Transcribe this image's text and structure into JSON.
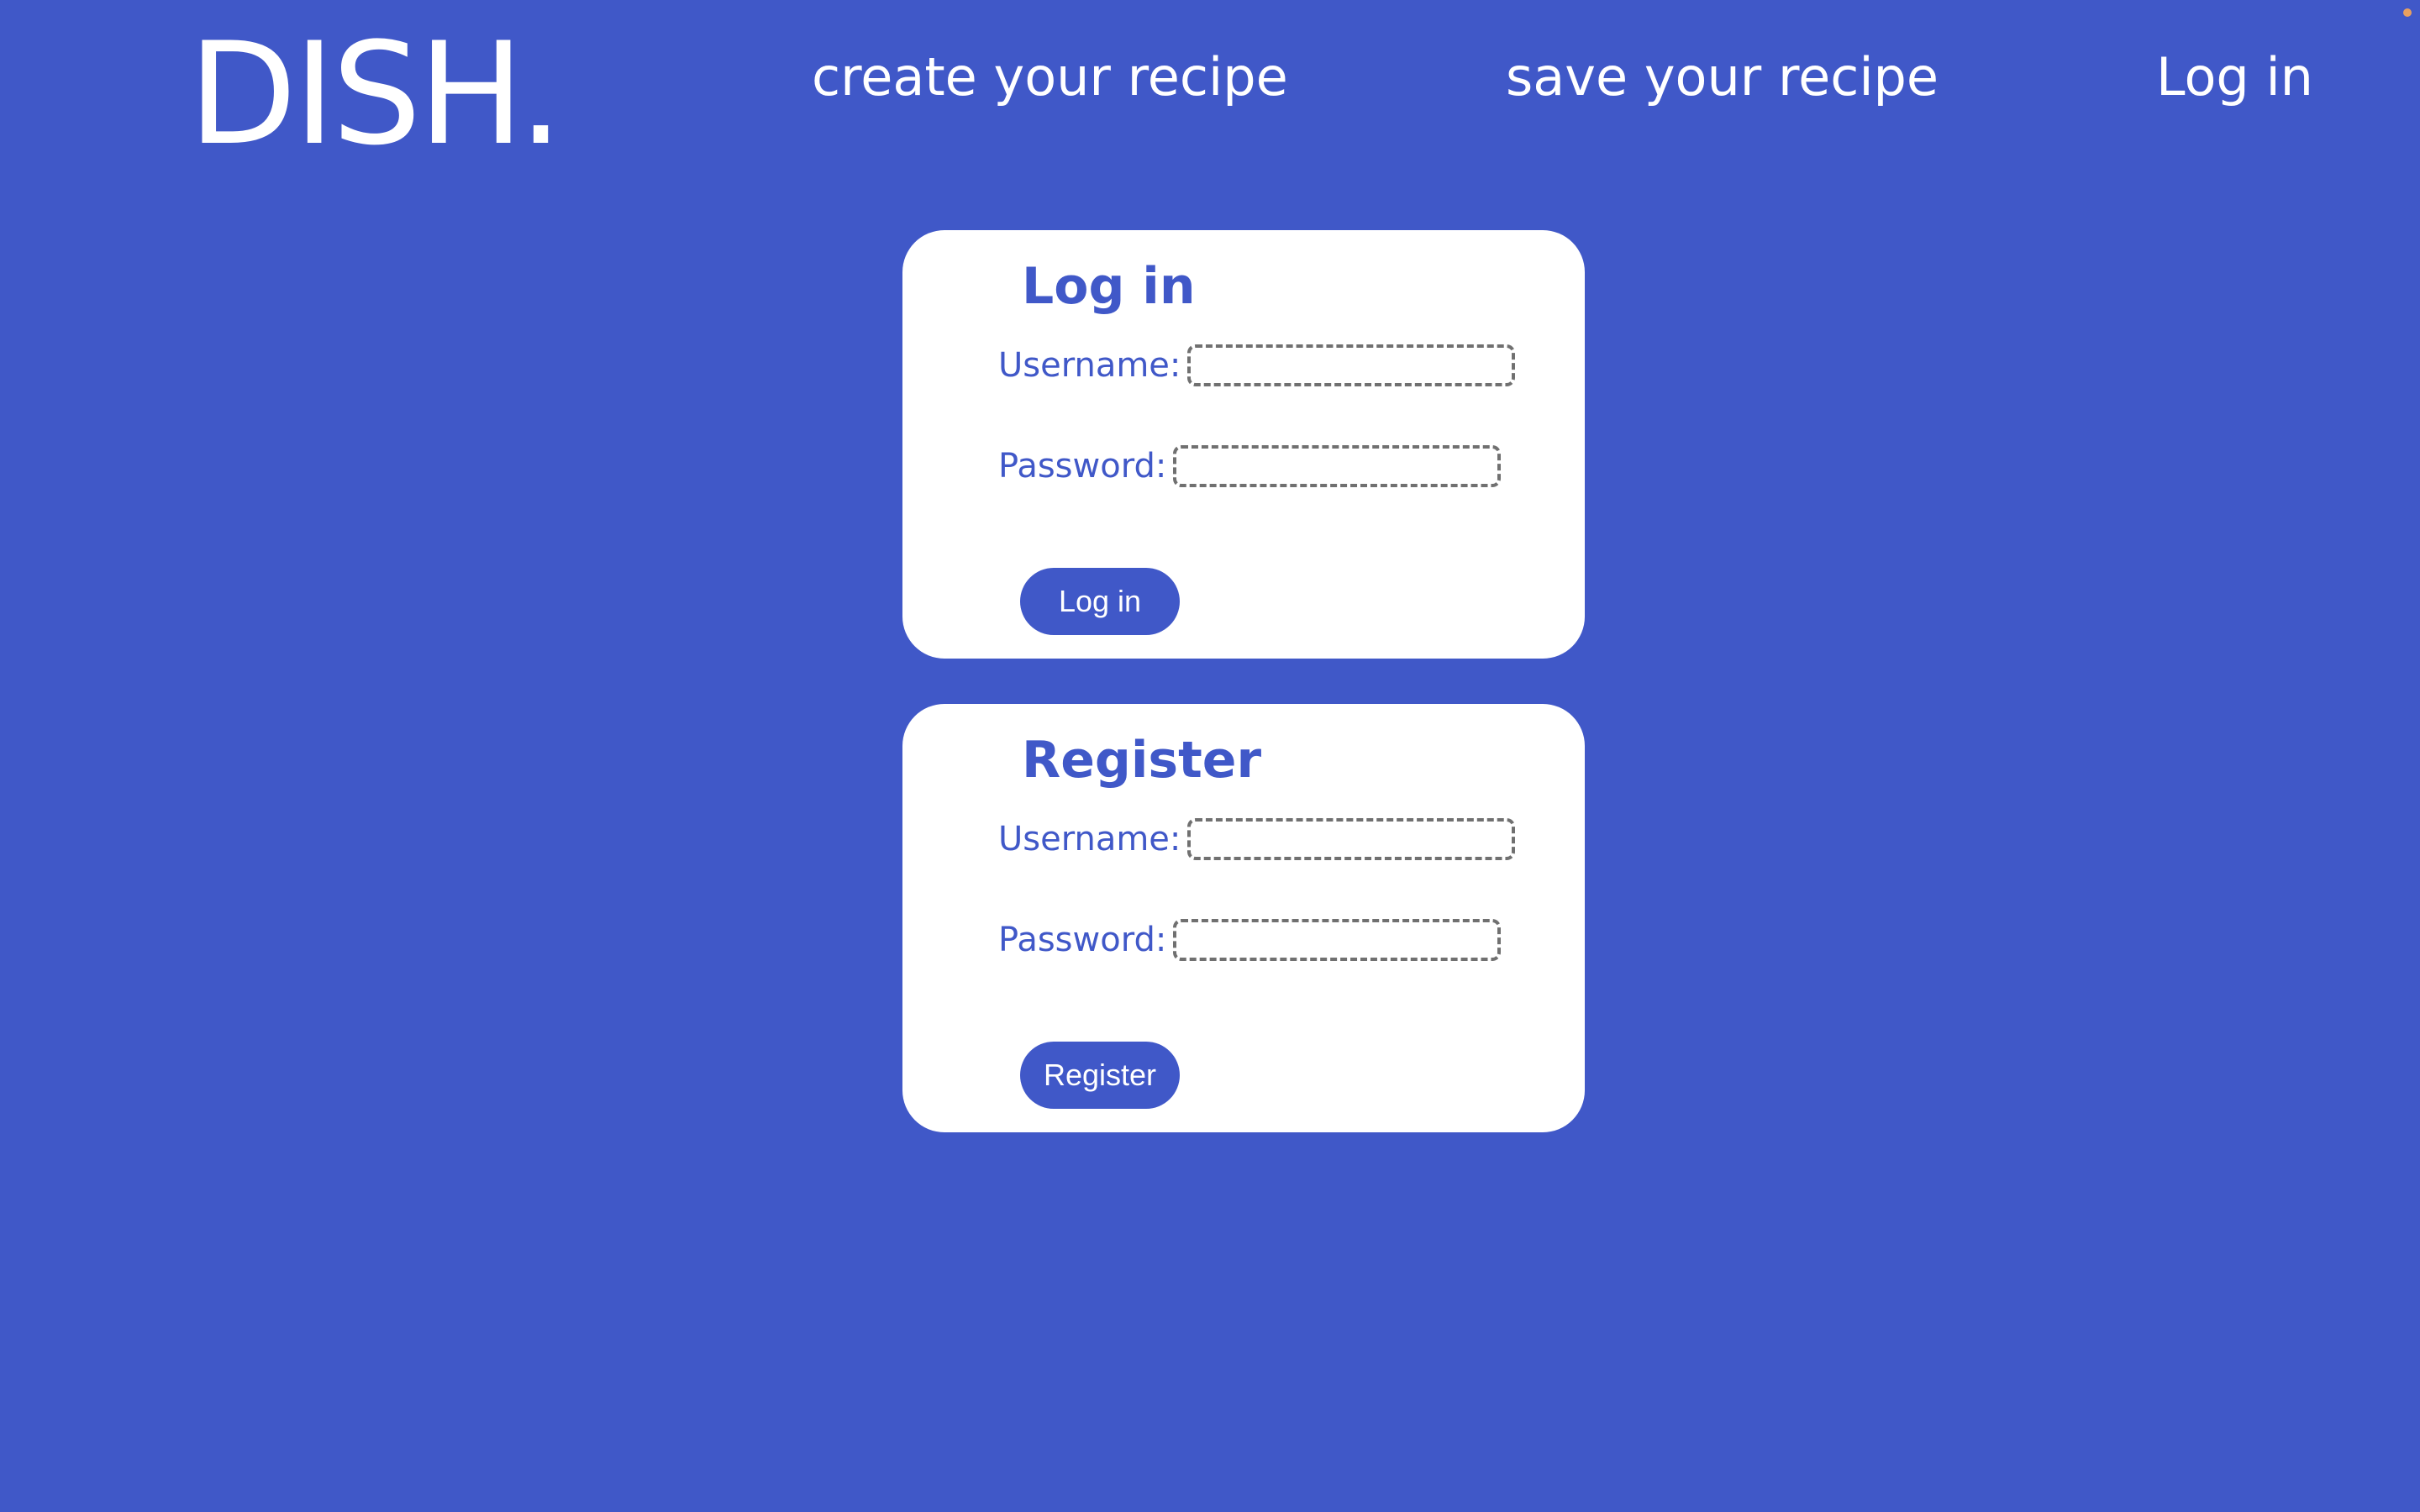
{
  "header": {
    "logo": "DISH.",
    "nav": {
      "create": "create your recipe",
      "save": "save your recipe",
      "login": "Log in"
    }
  },
  "login_form": {
    "title": "Log in",
    "username_label": "Username:",
    "username_value": "",
    "password_label": "Password:",
    "password_value": "",
    "button_label": "Log in"
  },
  "register_form": {
    "title": "Register",
    "username_label": "Username:",
    "username_value": "",
    "password_label": "Password:",
    "password_value": "",
    "button_label": "Register"
  },
  "colors": {
    "background": "#4058c8",
    "card": "#ffffff",
    "accent": "#4058c8",
    "input_border": "#707070"
  }
}
